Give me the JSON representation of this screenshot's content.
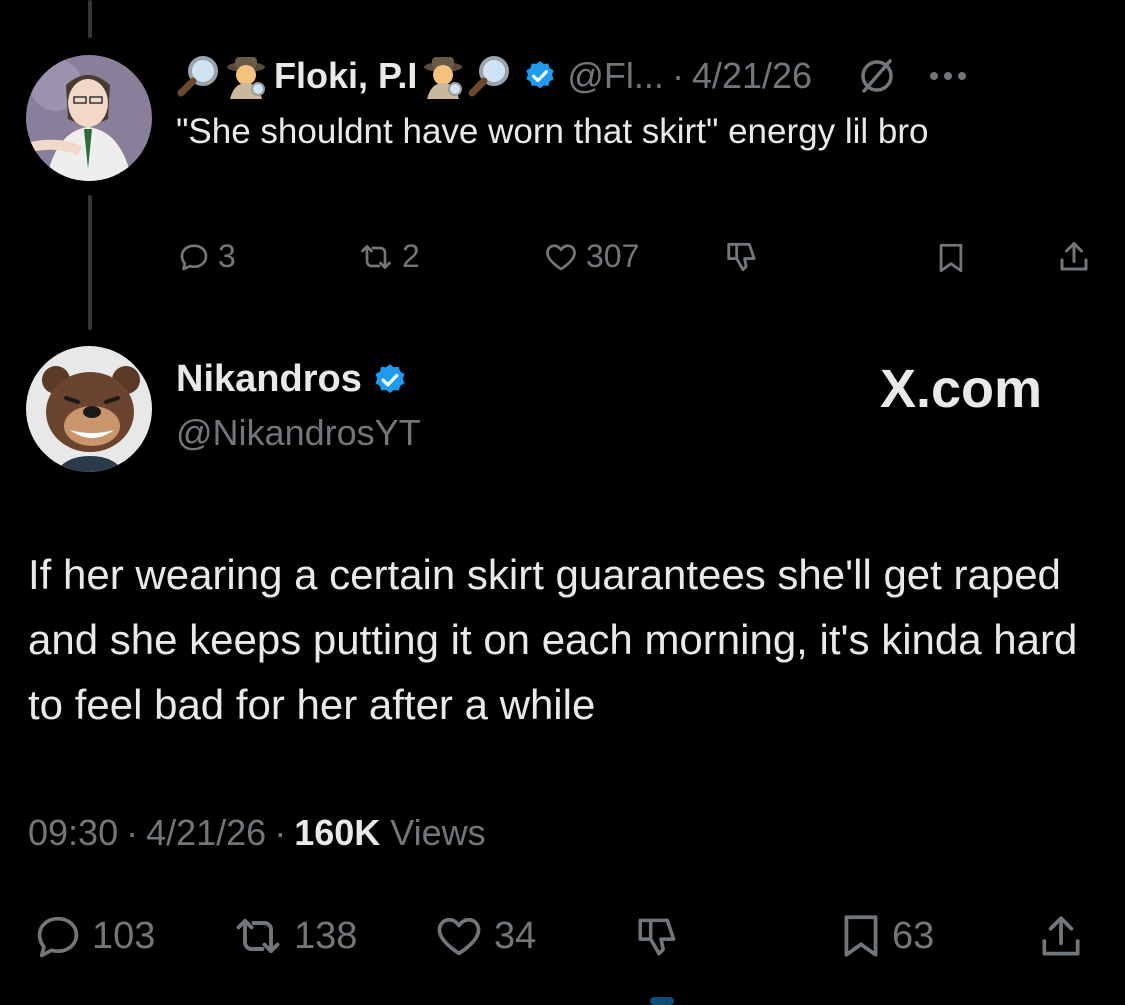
{
  "reply_tweet": {
    "name": "Floki, P.I",
    "leading_icons": [
      "magnifying-glass-icon",
      "detective-icon"
    ],
    "trailing_icons": [
      "detective-icon",
      "magnifying-glass-icon"
    ],
    "verified": true,
    "handle": "@Fl...",
    "separator": "·",
    "date": "4/21/26",
    "text": "\"She shouldnt have worn that skirt\" energy lil bro",
    "actions": {
      "replies": "3",
      "reposts": "2",
      "likes": "307"
    }
  },
  "main_tweet": {
    "name": "Nikandros",
    "verified": true,
    "handle": "@NikandrosYT",
    "watermark": "X.com",
    "text": "If her wearing a certain skirt guarantees she'll get raped and she keeps putting it on each morning, it's kinda hard to feel bad for her after a while",
    "time": "09:30",
    "separator": "·",
    "date": "4/21/26",
    "views_count": "160K",
    "views_label": "Views",
    "actions": {
      "replies": "103",
      "reposts": "138",
      "likes": "34",
      "bookmarks": "63"
    }
  },
  "colors": {
    "background": "#000000",
    "text": "#e7e9ea",
    "muted": "#71767b",
    "verified_blue": "#1d9bf0",
    "thread_line": "#333639"
  }
}
